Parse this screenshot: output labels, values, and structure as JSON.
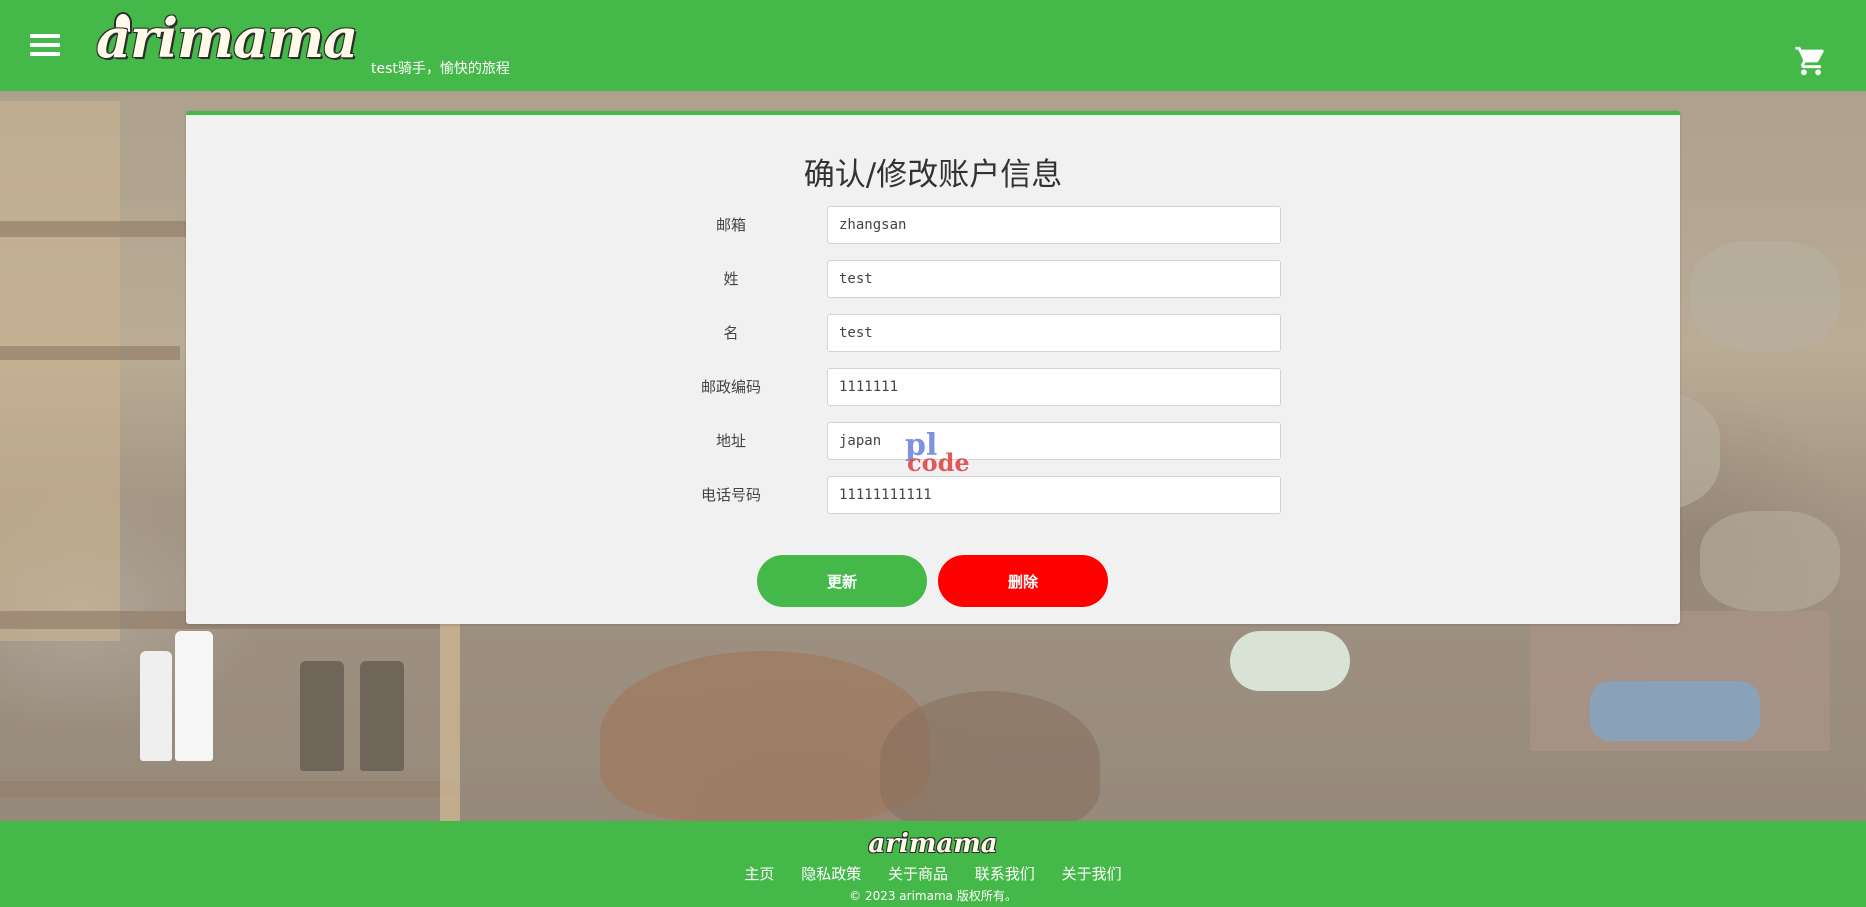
{
  "header": {
    "logo": "arimama",
    "tagline": "test骑手，愉快的旅程",
    "menu_icon": "hamburger-menu-icon",
    "cart_icon": "shopping-cart-icon"
  },
  "form": {
    "title": "确认/修改账户信息",
    "fields": [
      {
        "label": "邮箱",
        "value": "zhangsan"
      },
      {
        "label": "姓",
        "value": "test"
      },
      {
        "label": "名",
        "value": "test"
      },
      {
        "label": "邮政编码",
        "value": "1111111"
      },
      {
        "label": "地址",
        "value": "japan"
      },
      {
        "label": "电话号码",
        "value": "11111111111"
      }
    ],
    "update_label": "更新",
    "delete_label": "删除"
  },
  "watermark": {
    "line1": "pl",
    "line2": "code"
  },
  "footer": {
    "logo": "arimama",
    "links": [
      "主页",
      "隐私政策",
      "关于商品",
      "联系我们",
      "关于我们"
    ],
    "copyright": "© 2023 arimama 版权所有。"
  },
  "colors": {
    "brand_green": "#45b84a",
    "delete_red": "#ff0000",
    "card_bg": "#f1f1f1"
  }
}
